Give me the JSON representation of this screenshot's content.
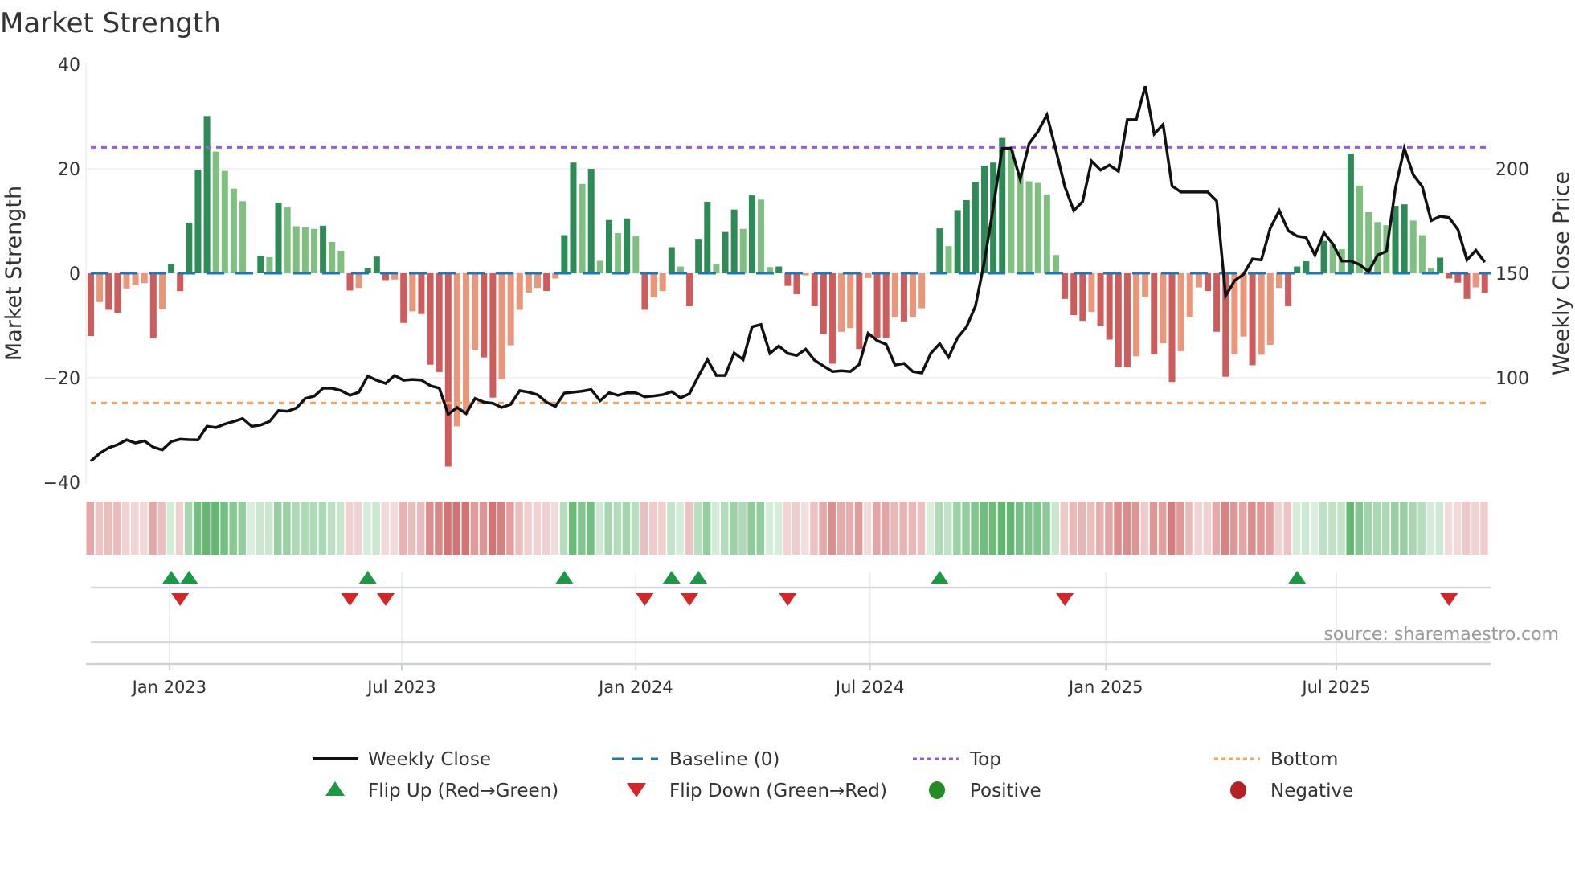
{
  "chart_data": {
    "type": "bar",
    "title": "Market Strength",
    "ylabel": "Market Strength",
    "y2label": "Weekly Close Price",
    "ylim": [
      -40,
      40
    ],
    "y2lim": [
      50,
      250
    ],
    "yticks": [
      "40",
      "20",
      "0",
      "−20",
      "−40"
    ],
    "ytick_values": [
      40,
      20,
      0,
      -20,
      -40
    ],
    "y2ticks": [
      "200",
      "150",
      "100"
    ],
    "y2tick_values": [
      200,
      150,
      100
    ],
    "x_unit": "week index",
    "x_ticks": [
      {
        "label": "Jan 2023",
        "at": 9.8
      },
      {
        "label": "Jul 2023",
        "at": 35.8
      },
      {
        "label": "Jan 2024",
        "at": 62.0
      },
      {
        "label": "Jul 2024",
        "at": 88.2
      },
      {
        "label": "Jan 2025",
        "at": 114.6
      },
      {
        "label": "Jul 2025",
        "at": 140.4
      }
    ],
    "top_level": 24.1,
    "bottom_level": -24.8,
    "baseline": 0,
    "strength": [
      -12,
      -5.5,
      -7,
      -7.6,
      -2.9,
      -2.3,
      -1.9,
      -12.4,
      -6.9,
      1.8,
      -3.4,
      9.7,
      19.8,
      30.1,
      23.3,
      19.6,
      16.2,
      13.8,
      0,
      3.3,
      3.1,
      13.5,
      12.6,
      9.0,
      8.8,
      8.5,
      9.1,
      6.0,
      4.3,
      -3.3,
      -2.8,
      1.0,
      3.2,
      -1.3,
      -1.2,
      -9.5,
      -7.3,
      -7.8,
      -17.5,
      -18.9,
      -37,
      -29.3,
      -27,
      -14.7,
      -16.1,
      -23.8,
      -20.3,
      -13.8,
      -7,
      -3.7,
      -2.8,
      -3.4,
      -1,
      7.3,
      21.2,
      17.1,
      20,
      2.4,
      10.2,
      7.7,
      10.5,
      7.1,
      -7,
      -4.6,
      -3.4,
      5,
      1.3,
      -6.3,
      6.6,
      13.7,
      1.8,
      7.9,
      12.2,
      8.5,
      14.9,
      14.1,
      1.2,
      1.3,
      -2.4,
      -4,
      -0.4,
      -6.3,
      -11.7,
      -17.3,
      -11.2,
      -10.5,
      -14.5,
      -0.9,
      -12.4,
      -12.4,
      -8.4,
      -9.2,
      -8.4,
      -6.7,
      0,
      8.6,
      5.2,
      12.1,
      14,
      17.4,
      20.6,
      21.2,
      25.9,
      23.6,
      19.3,
      17.6,
      17.3,
      15.1,
      3.5,
      -4.9,
      -8,
      -9.1,
      -7.4,
      -10.1,
      -12.7,
      -17.9,
      -18,
      -15.9,
      -4.5,
      -15.5,
      -13.4,
      -20.8,
      -14.9,
      -8.3,
      -2.7,
      -3.4,
      -11.2,
      -19.8,
      -15.5,
      -12.1,
      -17.6,
      -15.6,
      -13.7,
      -2.8,
      -6.3,
      1.3,
      2.3,
      0.2,
      6.2,
      5.6,
      4.6,
      22.9,
      16.8,
      11.7,
      9.8,
      9.2,
      12.9,
      13.2,
      10.1,
      7.3,
      1,
      3,
      -1,
      -1.8,
      -4.9,
      -2.7,
      -3.7
    ],
    "weekly_close": [
      60.1,
      63.9,
      66.5,
      68,
      70.3,
      68.8,
      69.8,
      66.8,
      65.5,
      69.5,
      70.6,
      70.4,
      70.3,
      76.8,
      76.2,
      77.9,
      79.1,
      80.5,
      76.8,
      77.4,
      79.1,
      84.3,
      84,
      85.5,
      90.1,
      91.2,
      95,
      95,
      93.9,
      91.6,
      93.1,
      100.8,
      98.8,
      97.3,
      101.1,
      98.8,
      99.2,
      98.9,
      96.2,
      95,
      82.5,
      85.8,
      82.9,
      90.1,
      88.3,
      87.8,
      85.8,
      87.3,
      93.9,
      93.1,
      91.9,
      88.3,
      86.3,
      92.7,
      93.1,
      93.6,
      94.4,
      89,
      92.8,
      91.6,
      92.8,
      92.8,
      90.9,
      91.3,
      91.9,
      93.4,
      90.4,
      92.4,
      100.8,
      108.7,
      101.1,
      101.1,
      111.9,
      108.7,
      124.4,
      125.5,
      111.7,
      115.2,
      111.7,
      110.7,
      113.7,
      108.4,
      105.6,
      103,
      103.4,
      103,
      106.4,
      121.3,
      117.8,
      116,
      106.1,
      106.9,
      103,
      102.3,
      111.7,
      116.3,
      109.9,
      119.1,
      124.4,
      134.3,
      155.6,
      181.6,
      209.8,
      209.8,
      195,
      212,
      217.8,
      225.8,
      209,
      191.5,
      180,
      184.3,
      203.7,
      199.4,
      201.8,
      198.8,
      223.5,
      223.5,
      239.5,
      216.6,
      221.2,
      191.8,
      188.9,
      188.9,
      188.9,
      188.9,
      184.6,
      139.2,
      146.5,
      149.5,
      156.9,
      156.4,
      171.6,
      180,
      170.4,
      167.8,
      167.1,
      158.7,
      169.4,
      164,
      155.9,
      155.9,
      154.1,
      150.8,
      158.7,
      160.5,
      190.7,
      209.8,
      197.1,
      191.5,
      175.2,
      177.3,
      176.7,
      170.9,
      156.4,
      161,
      155.3
    ],
    "flip_up_weeks": [
      10,
      12,
      32,
      54,
      66,
      69,
      96,
      136
    ],
    "flip_down_weeks": [
      11,
      30,
      34,
      63,
      68,
      79,
      110,
      153
    ],
    "legend": {
      "weekly_close": "Weekly Close",
      "baseline": "Baseline (0)",
      "top": "Top",
      "bottom": "Bottom",
      "flip_up": "Flip Up (Red→Green)",
      "flip_down": "Flip Down (Green→Red)",
      "positive": "Positive",
      "negative": "Negative"
    },
    "legend_placement": "bottom",
    "grid": true,
    "source": "source: sharemaestro.com",
    "colors": {
      "pos_strong": "#2e8b57",
      "pos_weak": "#7fbf7f",
      "neg_strong": "#cd5c5c",
      "neg_weak": "#e9967a",
      "line": "#111111",
      "baseline": "#1f77b4",
      "top": "#9b59d9",
      "bottom": "#f4a460",
      "flip_up": "#1a9a45",
      "flip_down": "#d62728",
      "positive": "#228b22",
      "negative": "#b22222"
    }
  }
}
